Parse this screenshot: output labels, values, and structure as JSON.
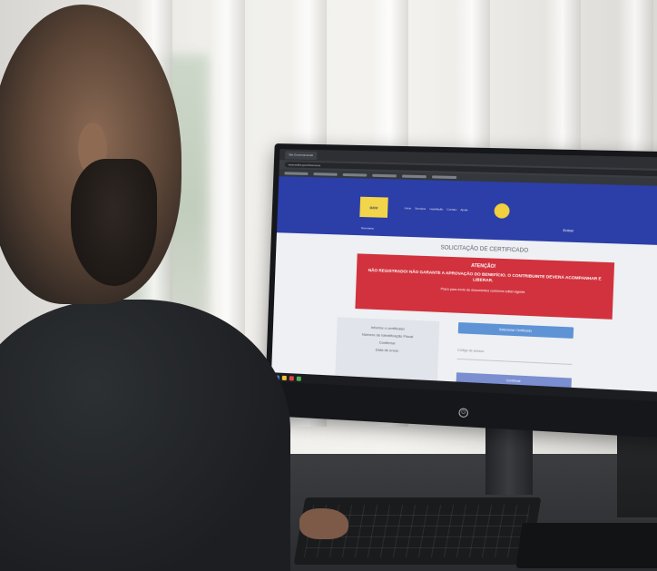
{
  "browser": {
    "tab_title": "Site Governamental",
    "address": "www.sefaz.gov.br/servicos"
  },
  "site": {
    "logo_text": "GOV",
    "nav": [
      "Início",
      "Serviços",
      "Legislação",
      "Contato",
      "Ajuda"
    ],
    "sub": "Secretaria",
    "login": "Entrar"
  },
  "page": {
    "heading": "SOLICITAÇÃO DE CERTIFICADO",
    "alert_title": "ATENÇÃO!",
    "alert_body": "NÃO REGISTRADO! NÃO GARANTE A APROVAÇÃO DO BENEFÍCIO. O CONTRIBUINTE DEVERÁ ACOMPANHAR E LIBERAR.",
    "alert_note": "Prazo para envio de documentos conforme edital vigente",
    "info_card": [
      "Informe o certificado",
      "Número de Identificação Fiscal",
      "Confirmar",
      "Data de envio"
    ],
    "primary_button": "Selecionar Certificado",
    "field_label": "Código de acesso",
    "submit_button": "Continuar"
  },
  "colors": {
    "header": "#2c3ea7",
    "alert": "#d1323d",
    "accent": "#f1cf3e"
  }
}
